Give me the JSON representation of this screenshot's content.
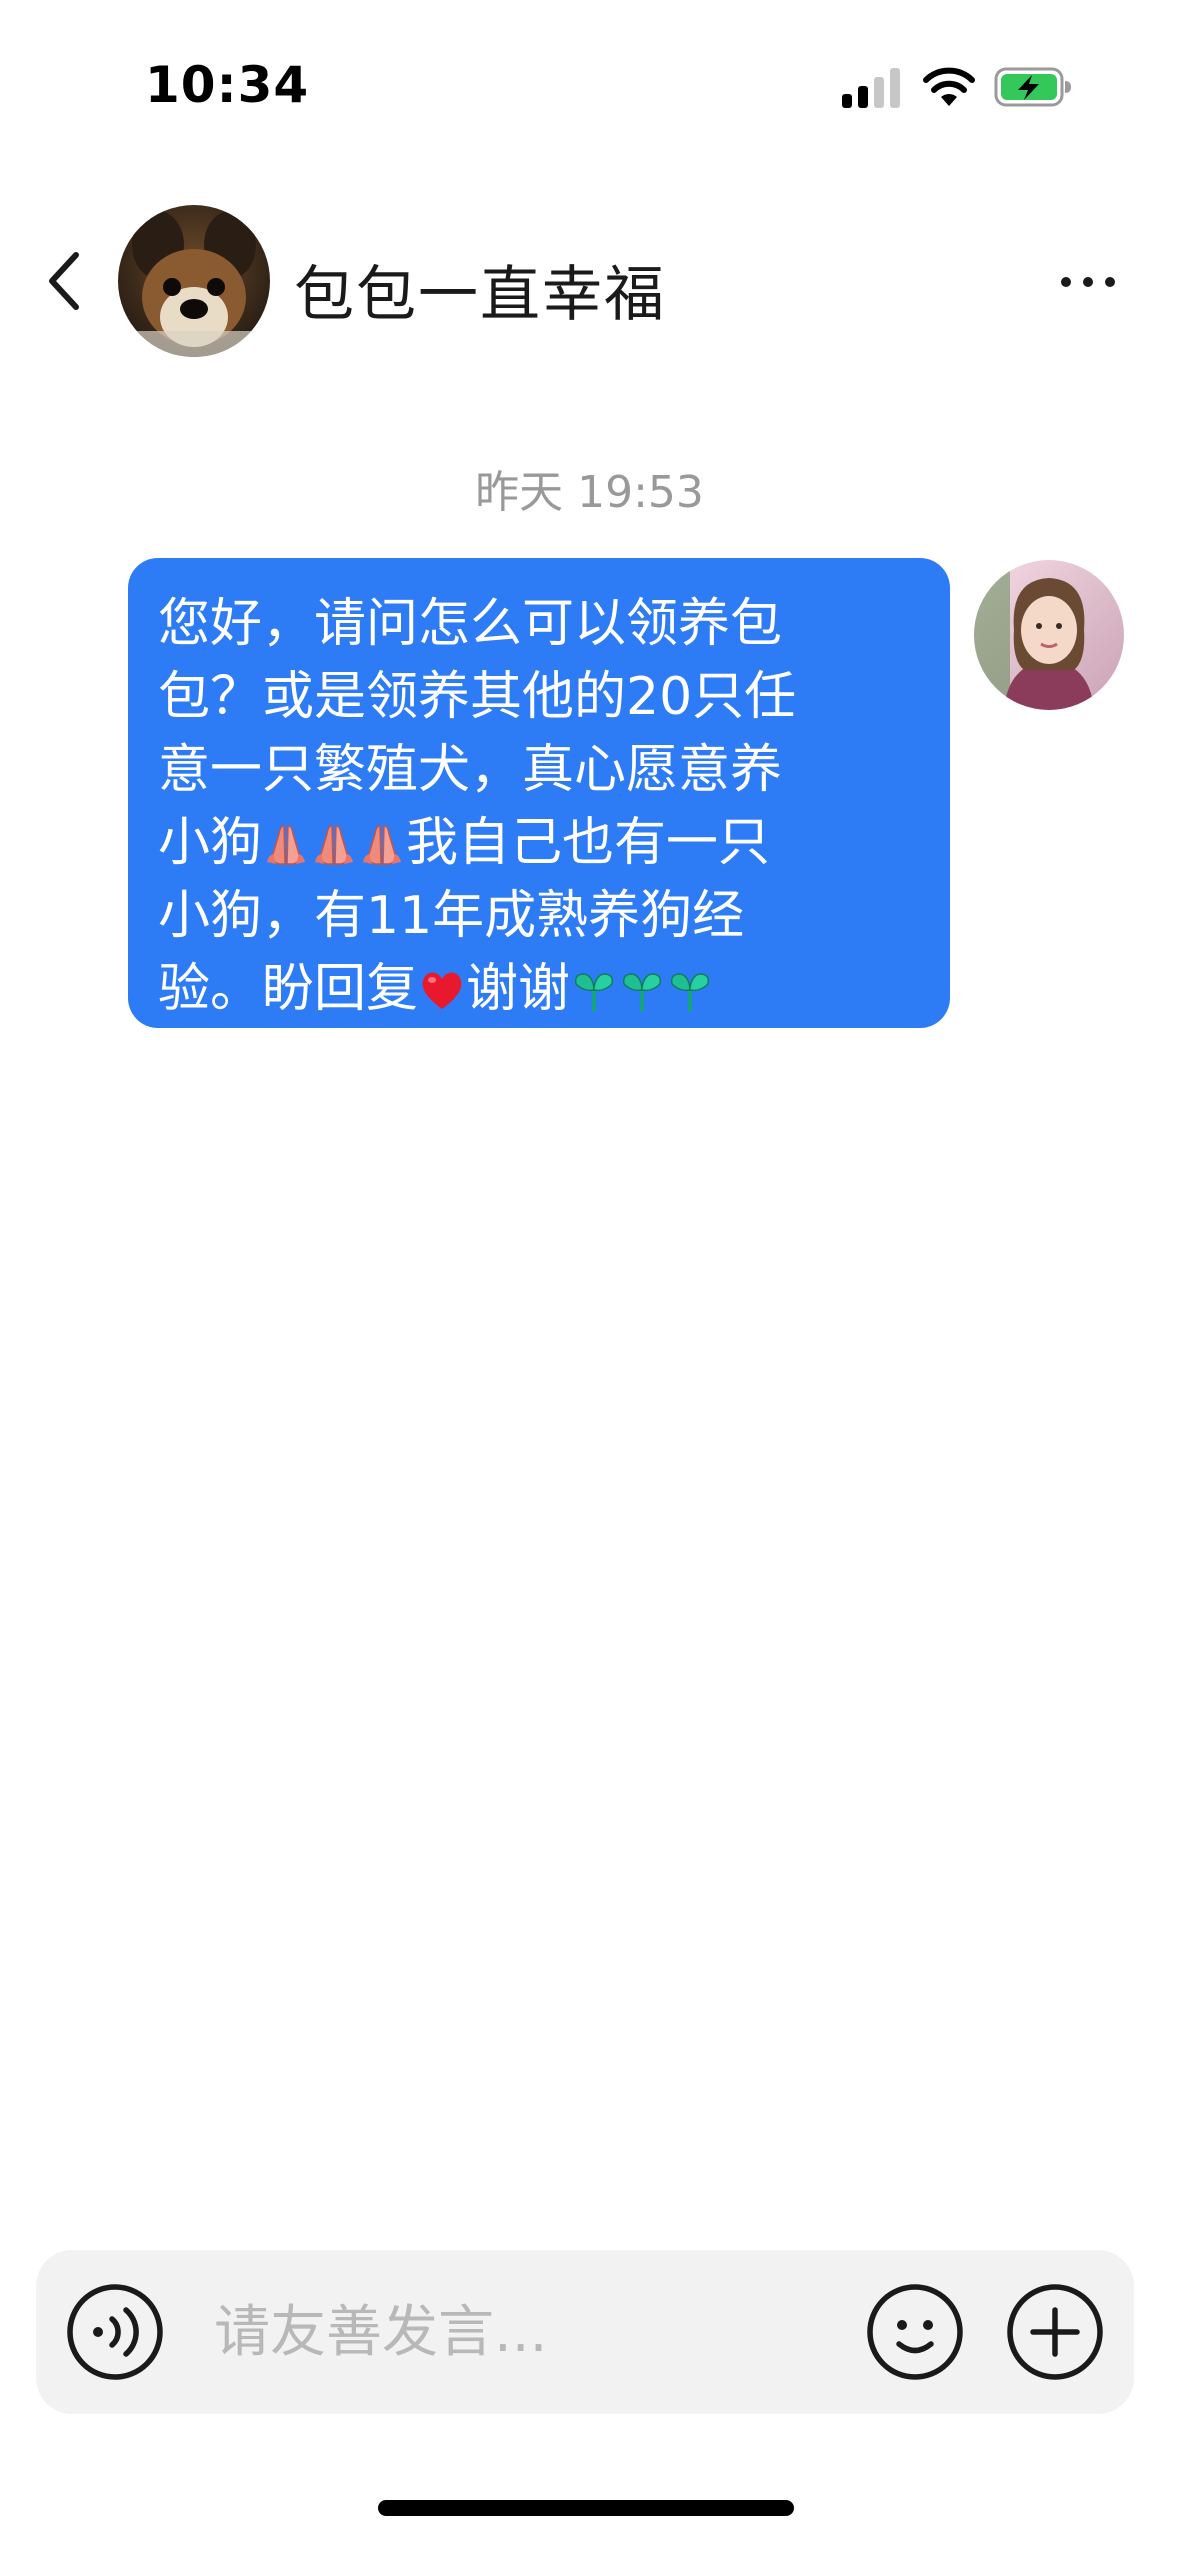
{
  "status_bar": {
    "time": "10:34",
    "battery_color": "#34c759",
    "signal_icon": "cellular-signal-icon",
    "wifi_icon": "wifi-icon",
    "battery_icon": "battery-charging-icon"
  },
  "header": {
    "contact_name": "包包一直幸福",
    "back_icon": "chevron-left-icon",
    "more_icon": "more-dots-icon"
  },
  "conversation": {
    "timestamp": "昨天 19:53",
    "messages": [
      {
        "sender": "self",
        "bubble_color": "#2d7cf6",
        "lines": [
          {
            "segments": [
              "您好，请问怎么可以领养包"
            ]
          },
          {
            "segments": [
              "包？或是领养其他的20只任"
            ]
          },
          {
            "segments": [
              "意一只繁殖犬，真心愿意养"
            ]
          },
          {
            "segments": [
              "小狗",
              "[pray]",
              "[pray]",
              "[pray]",
              "我自己也有一只"
            ]
          },
          {
            "segments": [
              "小狗，有11年成熟养狗经"
            ]
          },
          {
            "segments": [
              "验。盼回复",
              "[heart]",
              "谢谢",
              "[sprout]",
              "[sprout]",
              "[sprout]"
            ]
          }
        ]
      }
    ]
  },
  "input_bar": {
    "placeholder": "请友善发言...",
    "voice_icon": "voice-icon",
    "emoji_icon": "smiley-icon",
    "add_icon": "plus-circle-icon"
  }
}
